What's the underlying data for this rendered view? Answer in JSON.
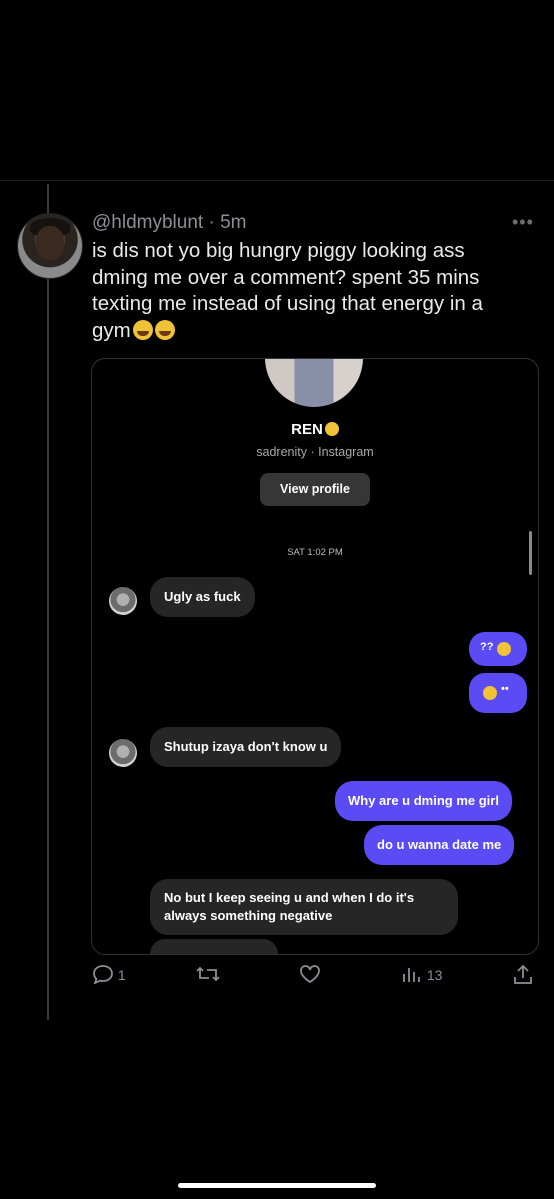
{
  "tweet": {
    "handle": "@hldmyblunt",
    "separator": " · ",
    "time": "5m",
    "more_icon": "more-icon",
    "text": "is dis not yo big hungry piggy looking ass dming me over a comment? spent 35 mins texting me instead of using that energy in a gym"
  },
  "dm": {
    "name": "REN",
    "subtitle": "sadrenity · Instagram",
    "view_profile_label": "View profile",
    "timestamp": "SAT 1:02 PM",
    "messages": [
      {
        "side": "in",
        "text": "Ugly as fuck"
      },
      {
        "side": "out",
        "text": "??"
      },
      {
        "side": "out",
        "text": "••"
      },
      {
        "side": "in",
        "text": "Shutup izaya don't know u"
      },
      {
        "side": "out",
        "text": "Why are u dming me girl"
      },
      {
        "side": "out",
        "text": "do u wanna date me"
      },
      {
        "side": "in",
        "text": "No but I keep seeing u and when I do it's always something negative"
      }
    ]
  },
  "actions": {
    "reply_count": "1",
    "views_count": "13"
  },
  "colors": {
    "background": "#000000",
    "accent_bubble": "#5b4bf4",
    "incoming_bubble": "#262626",
    "muted_text": "#8b8f94"
  }
}
